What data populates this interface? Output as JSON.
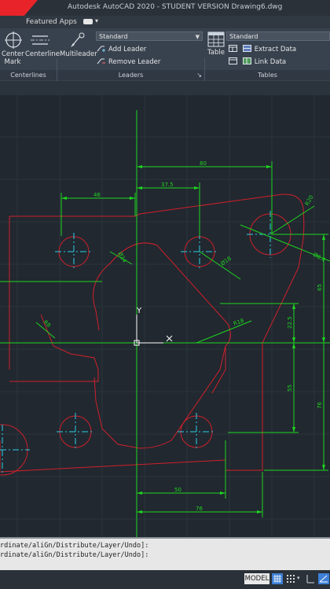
{
  "window": {
    "title": "Autodesk AutoCAD 2020 - STUDENT VERSION   Drawing6.dwg"
  },
  "menubar": {
    "featured_apps": "Featured Apps"
  },
  "ribbon": {
    "centerlines": {
      "center_mark": "Center Mark",
      "centerline": "Centerline",
      "panel_title": "Centerlines"
    },
    "leaders": {
      "multileader": "Multileader",
      "style": "Standard",
      "add_leader": "Add Leader",
      "remove_leader": "Remove Leader",
      "panel_title": "Leaders",
      "launcher": "↘"
    },
    "tables": {
      "table": "Table",
      "style": "Standard",
      "extract_data": "Extract Data",
      "link_data": "Link Data",
      "panel_title": "Tables"
    }
  },
  "colors": {
    "outline": "#d0202a",
    "dimension": "#1fd61f",
    "center": "#2ad0e6",
    "ucs": "#ffffff"
  },
  "drawing": {
    "dimensions": {
      "d80": "80",
      "d46": "46",
      "d375": "37.5",
      "r20": "R20",
      "d64": "Ø6.4",
      "d65": "65",
      "d24": "Ø24",
      "d18": "Ø18",
      "d225": "22.5",
      "r8": "R8",
      "r18": "R18",
      "d55": "55",
      "d76v": "76",
      "d50": "50",
      "d76h": "76"
    },
    "ucs_y": "Y",
    "ucs_x": "X"
  },
  "command": {
    "line1": "rdinate/aliGn/Distribute/Layer/Undo]:",
    "line2": "rdinate/aliGn/Distribute/Layer/Undo]:"
  },
  "status": {
    "model": "MODEL"
  }
}
